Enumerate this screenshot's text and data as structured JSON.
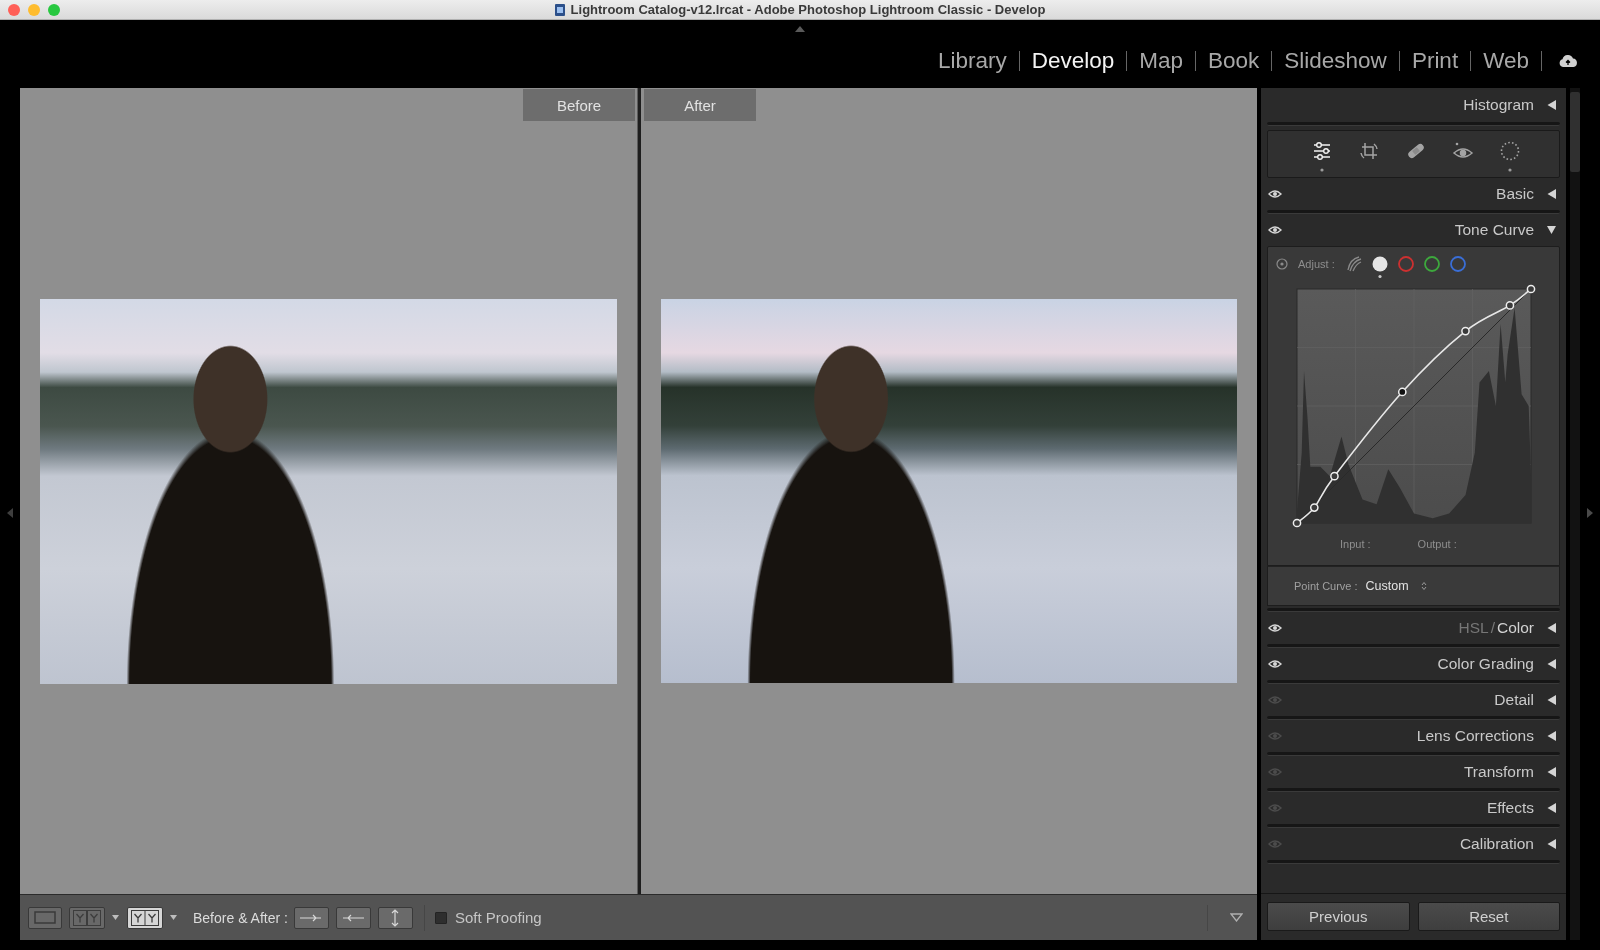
{
  "window": {
    "title": "Lightroom Catalog-v12.lrcat - Adobe Photoshop Lightroom Classic - Develop"
  },
  "modules": [
    {
      "label": "Library",
      "selected": false
    },
    {
      "label": "Develop",
      "selected": true
    },
    {
      "label": "Map",
      "selected": false
    },
    {
      "label": "Book",
      "selected": false
    },
    {
      "label": "Slideshow",
      "selected": false
    },
    {
      "label": "Print",
      "selected": false
    },
    {
      "label": "Web",
      "selected": false
    }
  ],
  "compare": {
    "panes": [
      {
        "kind": "before",
        "label": "Before"
      },
      {
        "kind": "after",
        "label": "After"
      }
    ]
  },
  "toolbar": {
    "view_modes": [
      {
        "kind": "loupe",
        "selected": false,
        "menu": false
      },
      {
        "kind": "left-right",
        "selected": false,
        "menu": true
      },
      {
        "kind": "split",
        "selected": true,
        "menu": true
      }
    ],
    "before_after_label": "Before & After :",
    "copy_buttons": [
      {
        "kind": "before-to-after"
      },
      {
        "kind": "after-to-before"
      },
      {
        "kind": "swap"
      }
    ],
    "soft_proofing": {
      "label": "Soft Proofing",
      "checked": false
    }
  },
  "right_panel": {
    "histogram": {
      "title": "Histogram",
      "expanded": false
    },
    "tools": [
      {
        "kind": "edit",
        "selected": true,
        "marked": true
      },
      {
        "kind": "crop",
        "selected": false,
        "marked": false
      },
      {
        "kind": "heal",
        "selected": false,
        "marked": false
      },
      {
        "kind": "red-eye",
        "selected": false,
        "marked": false
      },
      {
        "kind": "masking",
        "selected": false,
        "marked": true
      }
    ],
    "panels": [
      {
        "kind": "plain",
        "title": "Basic",
        "eye_on": true,
        "expanded": false
      },
      {
        "kind": "tone-curve",
        "title": "Tone Curve",
        "eye_on": true,
        "expanded": true,
        "curve": {
          "adjust_label": "Adjust :",
          "channels": [
            {
              "kind": "parametric",
              "selected": false
            },
            {
              "kind": "point",
              "selected": true,
              "color": "#e6e6e6"
            },
            {
              "kind": "red",
              "selected": false,
              "color": "#cc3030"
            },
            {
              "kind": "green",
              "selected": false,
              "color": "#3da83d"
            },
            {
              "kind": "blue",
              "selected": false,
              "color": "#3a6ed6"
            }
          ],
          "input_label": "Input :",
          "output_label": "Output :",
          "point_curve_label": "Point Curve :",
          "point_curve_value": "Custom"
        }
      },
      {
        "kind": "tabs",
        "tabs": [
          {
            "label": "HSL",
            "selected": false
          },
          {
            "label": "Color",
            "selected": true
          }
        ],
        "separator": "/",
        "eye_on": true,
        "expanded": false
      },
      {
        "kind": "plain",
        "title": "Color Grading",
        "eye_on": true,
        "expanded": false
      },
      {
        "kind": "plain",
        "title": "Detail",
        "eye_on": false,
        "expanded": false
      },
      {
        "kind": "plain",
        "title": "Lens Corrections",
        "eye_on": false,
        "expanded": false
      },
      {
        "kind": "plain",
        "title": "Transform",
        "eye_on": false,
        "expanded": false
      },
      {
        "kind": "plain",
        "title": "Effects",
        "eye_on": false,
        "expanded": false
      },
      {
        "kind": "plain",
        "title": "Calibration",
        "eye_on": false,
        "expanded": false
      }
    ],
    "buttons": [
      "Previous",
      "Reset"
    ]
  }
}
